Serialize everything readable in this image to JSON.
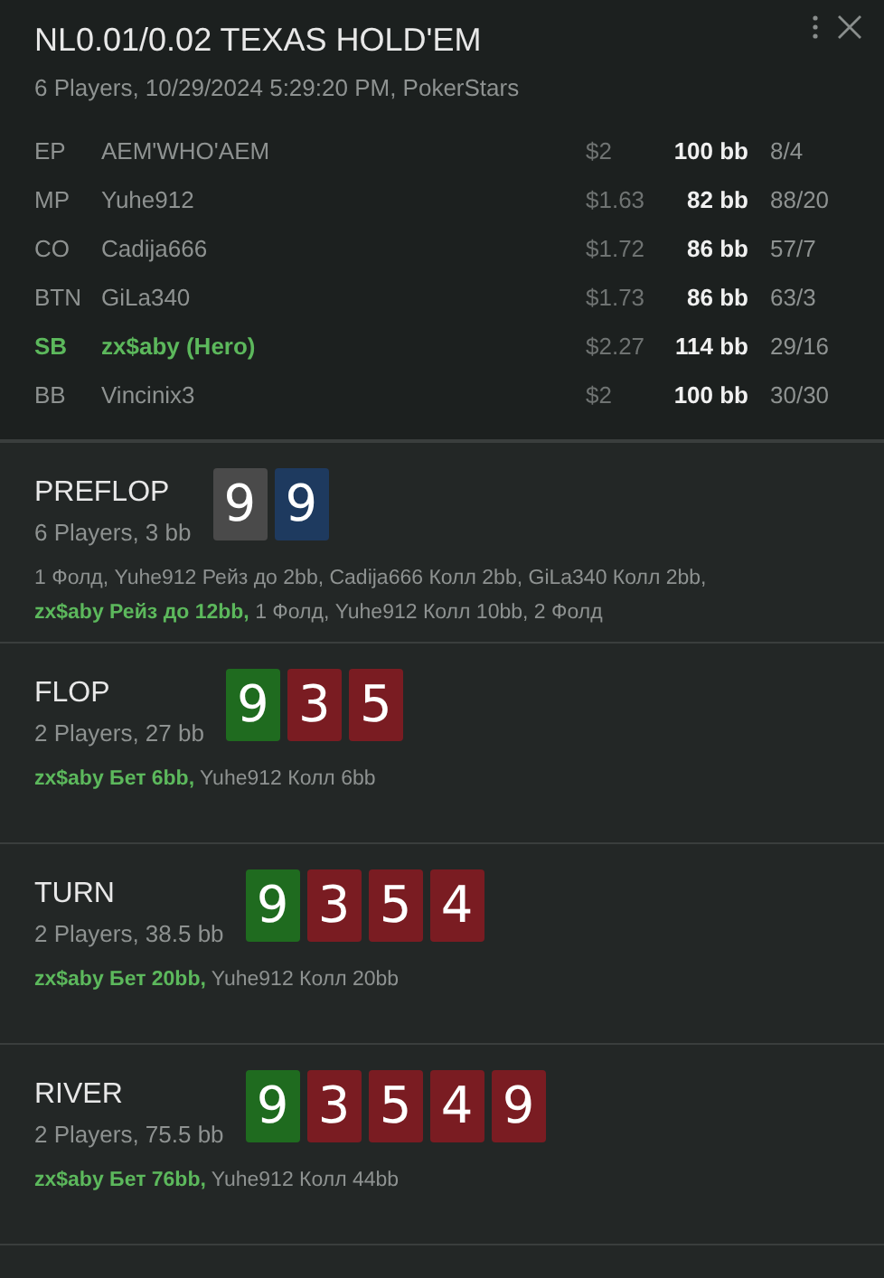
{
  "header": {
    "title": "NL0.01/0.02 TEXAS HOLD'EM",
    "subtitle": "6 Players, 10/29/2024 5:29:20 PM, PokerStars"
  },
  "players": [
    {
      "position": "EP",
      "name": "AEM'WHO'AEM",
      "stack": "$2",
      "bb": "100 bb",
      "stats": "8/4",
      "hero": false
    },
    {
      "position": "MP",
      "name": "Yuhe912",
      "stack": "$1.63",
      "bb": "82 bb",
      "stats": "88/20",
      "hero": false
    },
    {
      "position": "CO",
      "name": "Cadija666",
      "stack": "$1.72",
      "bb": "86 bb",
      "stats": "57/7",
      "hero": false
    },
    {
      "position": "BTN",
      "name": "GiLa340",
      "stack": "$1.73",
      "bb": "86 bb",
      "stats": "63/3",
      "hero": false
    },
    {
      "position": "SB",
      "name": "zx$aby (Hero)",
      "stack": "$2.27",
      "bb": "114 bb",
      "stats": "29/16",
      "hero": true
    },
    {
      "position": "BB",
      "name": "Vincinix3",
      "stack": "$2",
      "bb": "100 bb",
      "stats": "30/30",
      "hero": false
    }
  ],
  "streets": [
    {
      "name": "PREFLOP",
      "info": "6 Players, 3 bb",
      "cards": [
        {
          "rank": "9",
          "color": "#4a4a4a"
        },
        {
          "rank": "9",
          "color": "#1e3a5f"
        }
      ],
      "actions": "1 Фолд, Yuhe912 Рейз до 2bb, Cadija666 Колл 2bb, GiLa340 Колл 2bb, **zx$aby Рейз до 12bb,** 1 Фолд, Yuhe912 Колл 10bb, 2 Фолд"
    },
    {
      "name": "FLOP",
      "info": "2 Players, 27 bb",
      "cards": [
        {
          "rank": "9",
          "color": "#1f6b1f"
        },
        {
          "rank": "3",
          "color": "#7a1c22"
        },
        {
          "rank": "5",
          "color": "#7a1c22"
        }
      ],
      "actions": "**zx$aby Бет 6bb,** Yuhe912 Колл 6bb"
    },
    {
      "name": "TURN",
      "info": "2 Players, 38.5 bb",
      "cards": [
        {
          "rank": "9",
          "color": "#1f6b1f"
        },
        {
          "rank": "3",
          "color": "#7a1c22"
        },
        {
          "rank": "5",
          "color": "#7a1c22"
        },
        {
          "rank": "4",
          "color": "#7a1c22"
        }
      ],
      "actions": "**zx$aby Бет 20bb,** Yuhe912 Колл 20bb"
    },
    {
      "name": "RIVER",
      "info": "2 Players, 75.5 bb",
      "cards": [
        {
          "rank": "9",
          "color": "#1f6b1f"
        },
        {
          "rank": "3",
          "color": "#7a1c22"
        },
        {
          "rank": "5",
          "color": "#7a1c22"
        },
        {
          "rank": "4",
          "color": "#7a1c22"
        },
        {
          "rank": "9",
          "color": "#7a1c22"
        }
      ],
      "actions": "**zx$aby Бет 76bb,** Yuhe912 Колл 44bb"
    }
  ]
}
